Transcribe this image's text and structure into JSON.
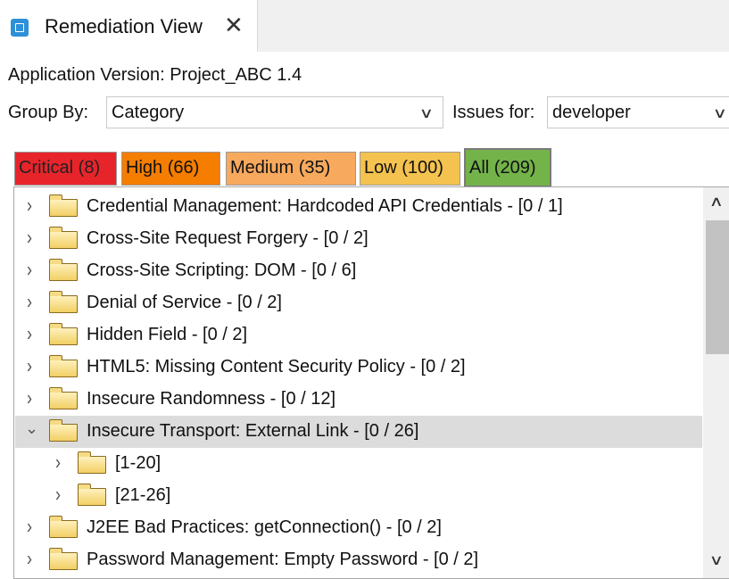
{
  "view_tab": {
    "title": "Remediation View",
    "icon": "view-icon",
    "close_glyph": "✕"
  },
  "application_version": "Application Version: Project_ABC 1.4",
  "group_by": {
    "label": "Group By:",
    "value": "Category"
  },
  "issues_for": {
    "label": "Issues for:",
    "value": "developer"
  },
  "severity_tabs": [
    {
      "label": "Critical (8)",
      "color": "#e8242b"
    },
    {
      "label": "High (66)",
      "color": "#f57d00"
    },
    {
      "label": "Medium (35)",
      "color": "#f7a95e"
    },
    {
      "label": "Low (100)",
      "color": "#f4c24e"
    },
    {
      "label": "All (209)",
      "color": "#73b34a",
      "selected": true
    }
  ],
  "tree": {
    "items": [
      {
        "label": "Credential Management: Hardcoded API Credentials - [0 / 1]",
        "expanded": false
      },
      {
        "label": "Cross-Site Request Forgery - [0 / 2]",
        "expanded": false
      },
      {
        "label": "Cross-Site Scripting: DOM - [0 / 6]",
        "expanded": false
      },
      {
        "label": "Denial of Service - [0 / 2]",
        "expanded": false
      },
      {
        "label": "Hidden Field - [0 / 2]",
        "expanded": false
      },
      {
        "label": "HTML5: Missing Content Security Policy - [0 / 2]",
        "expanded": false
      },
      {
        "label": "Insecure Randomness - [0 / 12]",
        "expanded": false
      },
      {
        "label": "Insecure Transport: External Link - [0 / 26]",
        "expanded": true,
        "selected": true
      },
      {
        "label": "[1-20]",
        "expanded": false,
        "child": true
      },
      {
        "label": "[21-26]",
        "expanded": false,
        "child": true
      },
      {
        "label": "J2EE Bad Practices: getConnection() - [0 / 2]",
        "expanded": false
      },
      {
        "label": "Password Management: Empty Password - [0 / 2]",
        "expanded": false
      }
    ]
  }
}
